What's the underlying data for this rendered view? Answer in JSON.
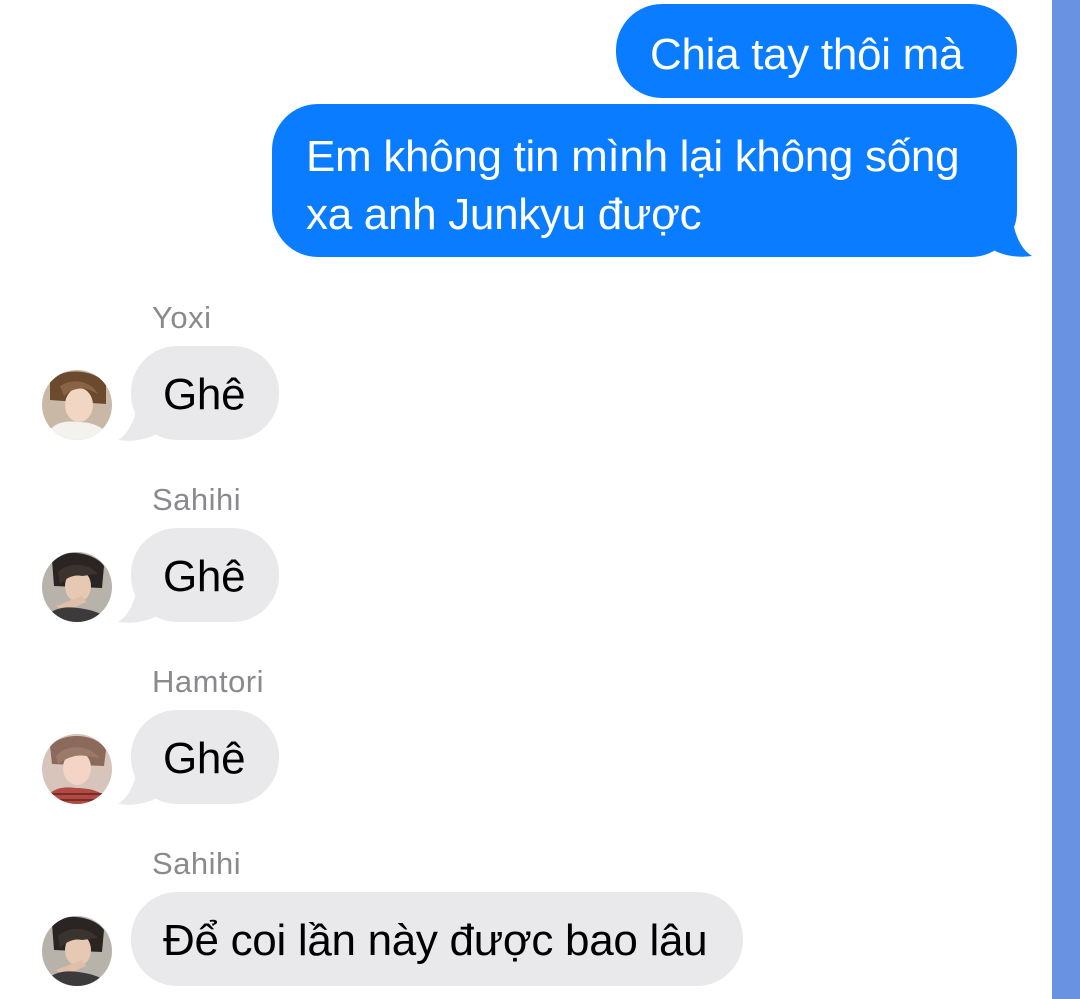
{
  "colors": {
    "outgoing_bubble": "#0a7cff",
    "incoming_bubble": "#e9e9eb",
    "sender_name": "#8a8a8e",
    "side_strip": "#6a92e3"
  },
  "messages": [
    {
      "direction": "outgoing",
      "text": "Chia tay thôi mà"
    },
    {
      "direction": "outgoing",
      "text": "Em không tin mình lại không sống xa anh Junkyu được"
    },
    {
      "direction": "incoming",
      "sender": "Yoxi",
      "avatar": "yoxi-avatar",
      "text": "Ghê"
    },
    {
      "direction": "incoming",
      "sender": "Sahihi",
      "avatar": "sahihi-avatar",
      "text": "Ghê"
    },
    {
      "direction": "incoming",
      "sender": "Hamtori",
      "avatar": "hamtori-avatar",
      "text": "Ghê"
    },
    {
      "direction": "incoming",
      "sender": "Sahihi",
      "avatar": "sahihi-avatar",
      "text": "Để coi lần này được bao lâu"
    }
  ]
}
